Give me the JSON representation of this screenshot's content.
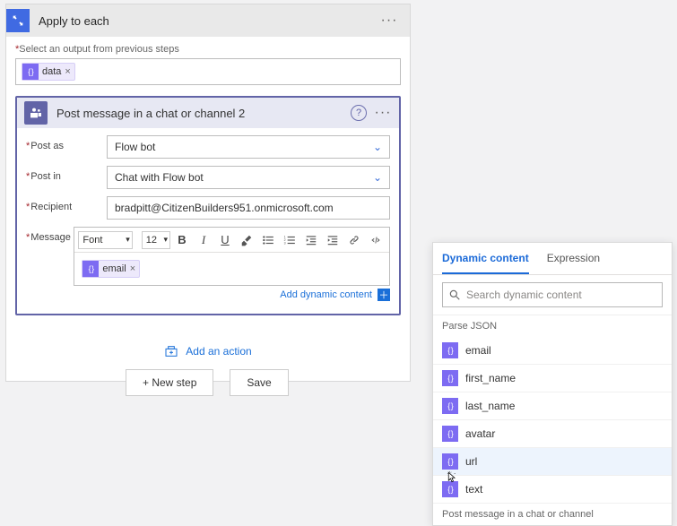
{
  "outer": {
    "title": "Apply to each",
    "select_label": "Select an output from previous steps",
    "token": {
      "label": "data"
    }
  },
  "inner": {
    "title": "Post message in a chat or channel 2",
    "fields": {
      "post_as": {
        "label": "Post as",
        "value": "Flow bot"
      },
      "post_in": {
        "label": "Post in",
        "value": "Chat with Flow bot"
      },
      "recipient": {
        "label": "Recipient",
        "value": "bradpitt@CitizenBuilders951.onmicrosoft.com"
      },
      "message": {
        "label": "Message"
      }
    },
    "toolbar": {
      "font": "Font",
      "size": "12"
    },
    "message_token": {
      "label": "email"
    },
    "add_dynamic": "Add dynamic content",
    "add_action": "Add an action"
  },
  "buttons": {
    "new_step": "+ New step",
    "save": "Save"
  },
  "dyn": {
    "tabs": {
      "dynamic": "Dynamic content",
      "expression": "Expression"
    },
    "search_placeholder": "Search dynamic content",
    "sections": [
      {
        "title": "Parse JSON",
        "items": [
          "email",
          "first_name",
          "last_name",
          "avatar",
          "url",
          "text"
        ]
      }
    ],
    "section2_title": "Post message in a chat or channel"
  }
}
